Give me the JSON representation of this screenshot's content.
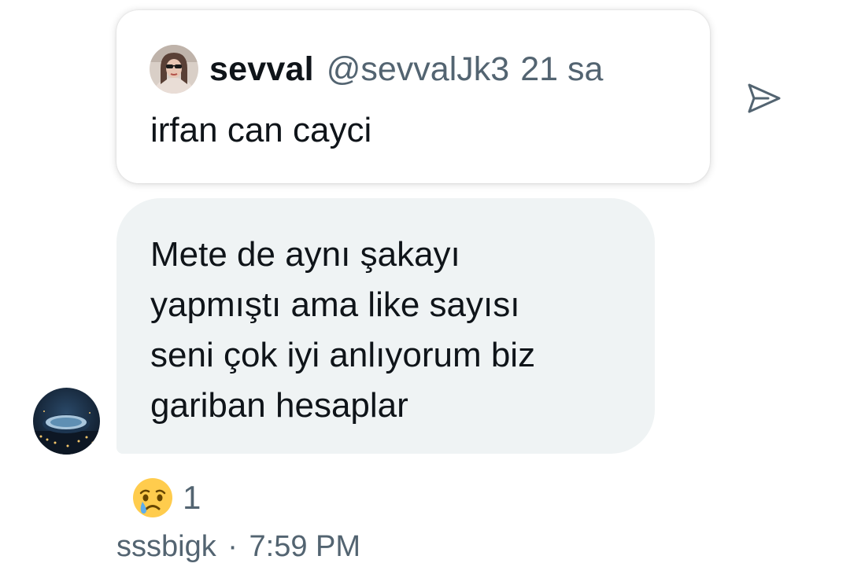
{
  "quoted_tweet": {
    "author_name": "sevval",
    "author_handle": "@sevvalJk3",
    "time_ago": "21 sa",
    "text": "irfan can cayci",
    "avatar_icon": "profile-photo"
  },
  "share_icon": "send-icon",
  "reply": {
    "lines": [
      "Mete de aynı şakayı",
      "yapmıştı ama like sayısı",
      "seni çok iyi anlıyorum biz",
      "gariban hesaplar"
    ],
    "sender_avatar_icon": "stadium-night-photo"
  },
  "reaction": {
    "emoji_icon": "crying-face-emoji",
    "count": "1"
  },
  "meta": {
    "sender": "sssbigk",
    "separator": "·",
    "time": "7:59 PM"
  },
  "colors": {
    "primary_text": "#0f1419",
    "secondary_text": "#536471",
    "bubble_bg": "#eff3f4",
    "icon_stroke": "#536471"
  }
}
